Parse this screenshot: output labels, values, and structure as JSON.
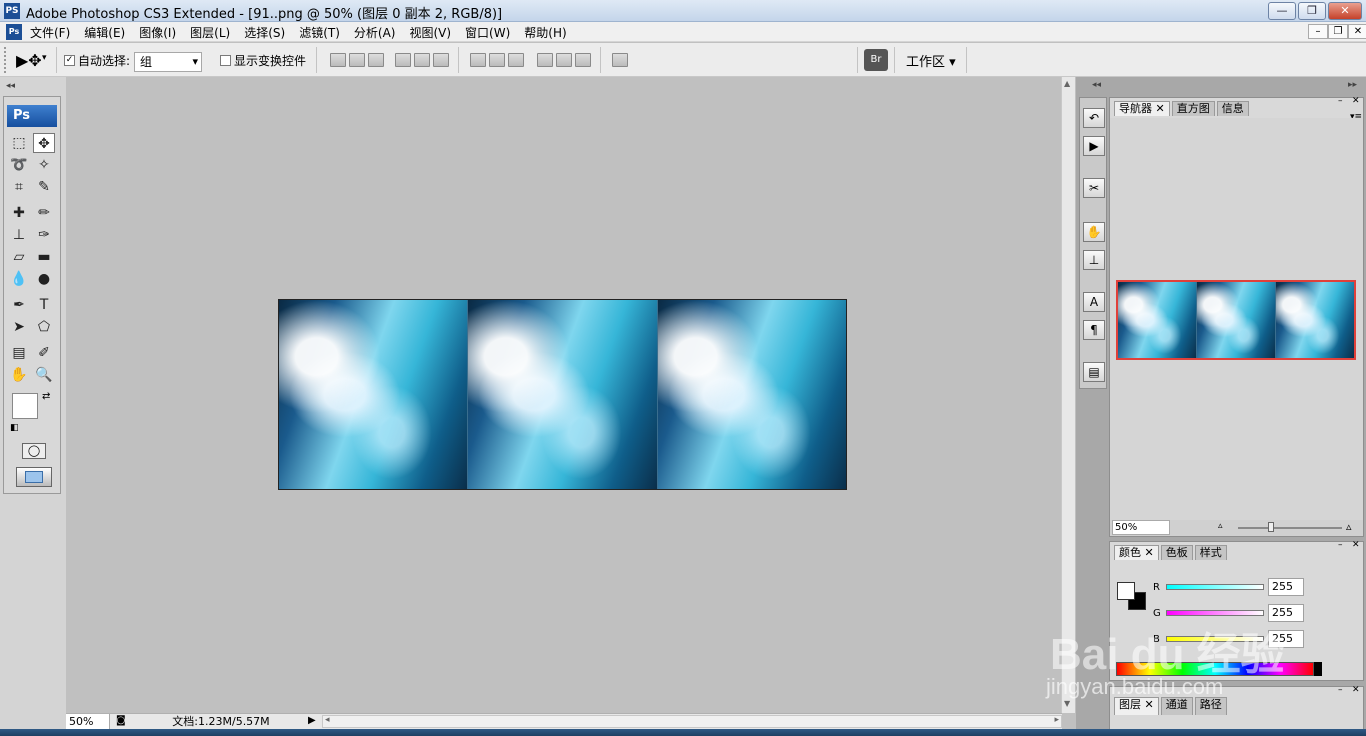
{
  "window": {
    "app_icon": "PS",
    "title": "Adobe Photoshop CS3 Extended - [91..png @ 50% (图层 0 副本 2, RGB/8)]",
    "controls": [
      "minimize-icon",
      "restore-icon",
      "close-icon"
    ]
  },
  "menu": {
    "items": [
      "文件(F)",
      "编辑(E)",
      "图像(I)",
      "图层(L)",
      "选择(S)",
      "滤镜(T)",
      "分析(A)",
      "视图(V)",
      "窗口(W)",
      "帮助(H)"
    ]
  },
  "options": {
    "auto_select_checked": true,
    "auto_select_label": "自动选择:",
    "auto_select_value": "组",
    "show_transform_checked": false,
    "show_transform_label": "显示变换控件",
    "workspace_label": "工作区"
  },
  "toolbox": {
    "header": "Ps"
  },
  "status": {
    "zoom": "50%",
    "doc": "文档:1.23M/5.57M"
  },
  "navigator": {
    "tabs": [
      "导航器",
      "直方图",
      "信息"
    ],
    "zoom": "50%"
  },
  "color_panel": {
    "tabs": [
      "颜色",
      "色板",
      "样式"
    ],
    "r_label": "R",
    "g_label": "G",
    "b_label": "B",
    "r": "255",
    "g": "255",
    "b": "255"
  },
  "layers_panel": {
    "tabs": [
      "图层",
      "通道",
      "路径"
    ]
  },
  "watermark": {
    "brand": "Bai du 经验",
    "url": "jingyan.baidu.com"
  },
  "colors": {
    "title_bar": "#c4d5ea",
    "nav_highlight": "#e0403a",
    "canvas_bg": "#c0c0c0"
  }
}
